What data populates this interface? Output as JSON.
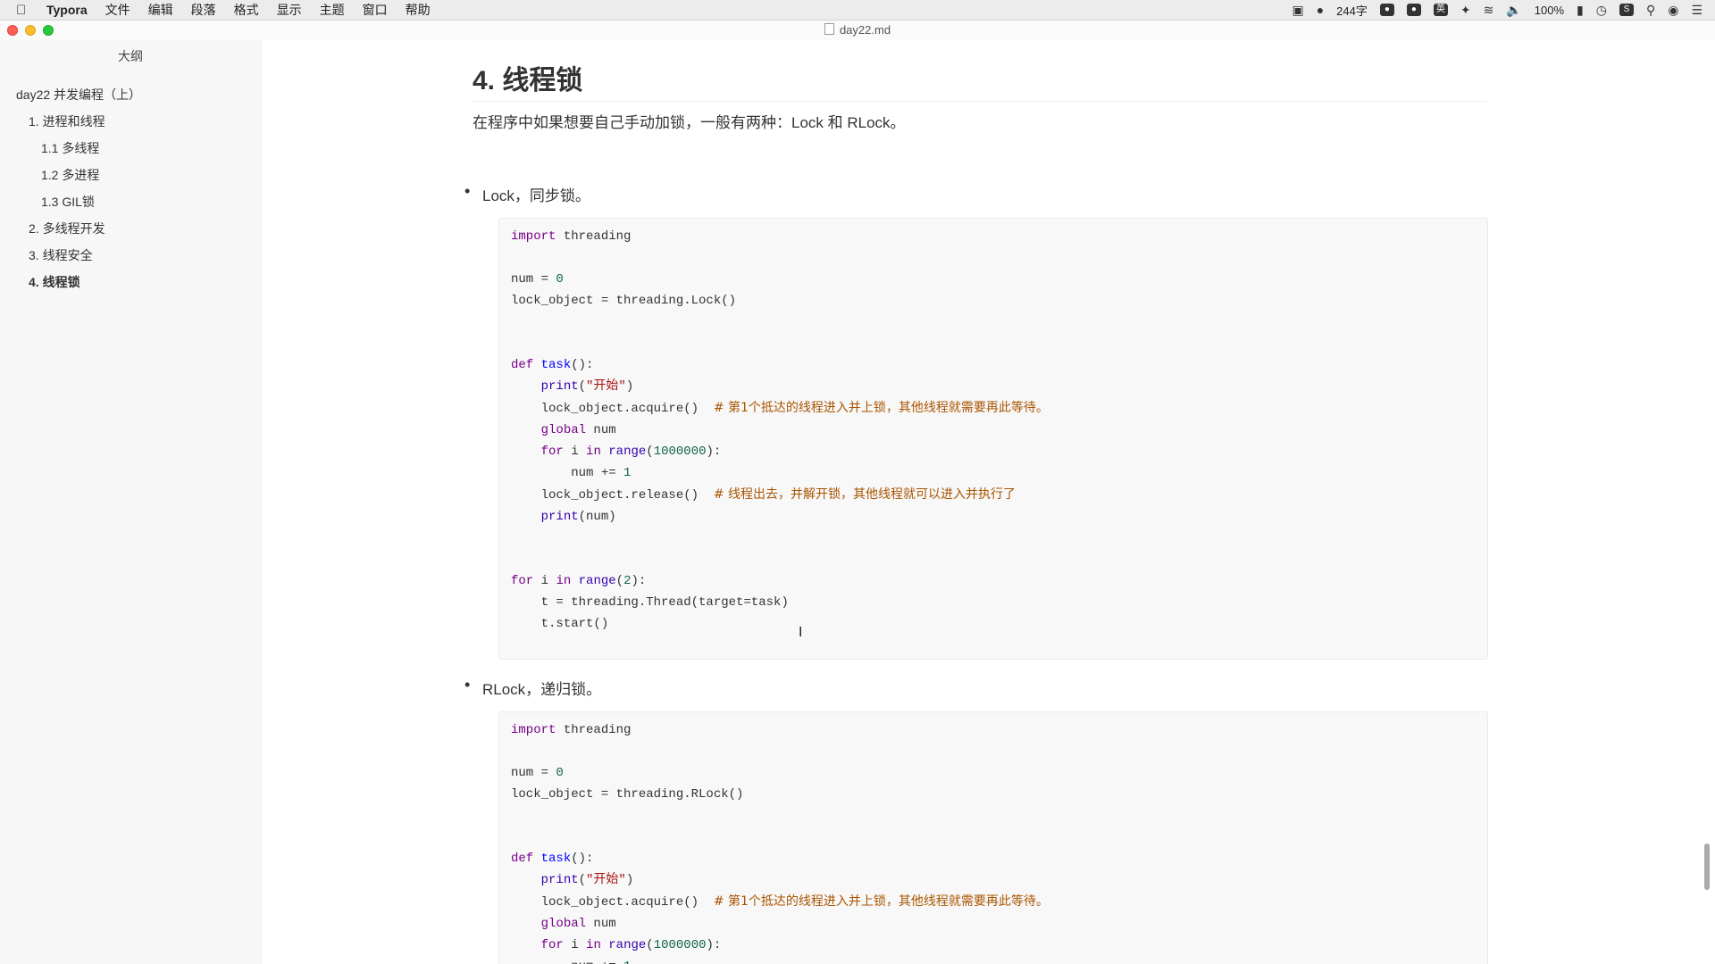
{
  "menubar": {
    "app_name": "Typora",
    "items": [
      "文件",
      "编辑",
      "段落",
      "格式",
      "显示",
      "主题",
      "窗口",
      "帮助"
    ],
    "word_count": "244字",
    "battery": "100%"
  },
  "window": {
    "title": "day22.md"
  },
  "sidebar": {
    "title": "大纲",
    "items": [
      {
        "label": "day22 并发编程（上）",
        "level": 1,
        "active": false
      },
      {
        "label": "1. 进程和线程",
        "level": 2,
        "active": false
      },
      {
        "label": "1.1 多线程",
        "level": 3,
        "active": false
      },
      {
        "label": "1.2 多进程",
        "level": 3,
        "active": false
      },
      {
        "label": "1.3 GIL锁",
        "level": 3,
        "active": false
      },
      {
        "label": "2. 多线程开发",
        "level": 2,
        "active": false
      },
      {
        "label": "3. 线程安全",
        "level": 2,
        "active": false
      },
      {
        "label": "4. 线程锁",
        "level": 2,
        "active": true
      }
    ]
  },
  "doc": {
    "heading": "4. 线程锁",
    "intro": "在程序中如果想要自己手动加锁，一般有两种：Lock 和 RLock。",
    "bullets": [
      "Lock，同步锁。",
      "RLock，递归锁。"
    ],
    "code": {
      "import_line": "threading",
      "num_line": "num = ",
      "zero": "0",
      "lock_line": "lock_object = threading.Lock()",
      "rlock_line": "lock_object = threading.RLock()",
      "task_name": "task",
      "start_str": "\"开始\"",
      "acquire": "    lock_object.acquire()  ",
      "comment_acquire": "# 第1个抵达的线程进入并上锁，其他线程就需要再此等待。",
      "global_var": " num",
      "loop_count": "1000000",
      "inc_line": "        num += ",
      "one": "1",
      "release": "    lock_object.release()  ",
      "comment_release": "# 线程出去，并解开锁，其他线程就可以进入并执行了",
      "print_num": "(num)",
      "thread_count": "2",
      "thread_line": "    t = threading.Thread(target=task)",
      "start_call": "    t.start()"
    }
  },
  "colors": {
    "keyword": "#770088",
    "function": "#0000ff",
    "number": "#116644",
    "string": "#aa1111",
    "comment": "#aa5500"
  }
}
